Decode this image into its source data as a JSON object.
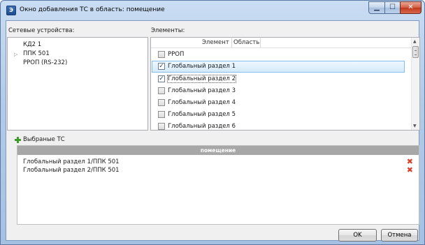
{
  "window": {
    "title": "Окно добавления ТС в область: помещение",
    "app_icon_glyph": "Э"
  },
  "title_controls": {
    "minimize": "▁",
    "maximize": "☐",
    "close": "✕"
  },
  "network_devices": {
    "label": "Сетевые устройства:",
    "items": [
      {
        "label": "КД2 1",
        "expandable": false
      },
      {
        "label": "ППК 501",
        "expandable": true
      },
      {
        "label": "PPOП (RS-232)",
        "expandable": false
      }
    ]
  },
  "elements": {
    "label": "Элементы:",
    "columns": [
      "Элемент",
      "Область"
    ],
    "rows": [
      {
        "label": "PPOП",
        "checked": false
      },
      {
        "label": "Глобальный раздел 1",
        "checked": true,
        "selected": true
      },
      {
        "label": "Глобальный раздел 2",
        "checked": true,
        "focused": true
      },
      {
        "label": "Глобальный раздел 3",
        "checked": false
      },
      {
        "label": "Глобальный раздел 4",
        "checked": false
      },
      {
        "label": "Глобальный раздел 5",
        "checked": false
      },
      {
        "label": "Глобальный раздел 6",
        "checked": false
      }
    ]
  },
  "selected_ts": {
    "label": "Выбраные ТС",
    "header": "помещение",
    "rows": [
      {
        "label": "Глобальный раздел 1/ППК 501"
      },
      {
        "label": "Глобальный раздел 2/ППК 501"
      }
    ]
  },
  "buttons": {
    "ok": "OK",
    "cancel": "Отмена"
  },
  "colors": {
    "selection_fill": "#d3eafc",
    "selection_border": "#84bcec",
    "header_gray": "#a7a7a7",
    "delete_red": "#d9412c",
    "add_green": "#3b9b2b"
  }
}
